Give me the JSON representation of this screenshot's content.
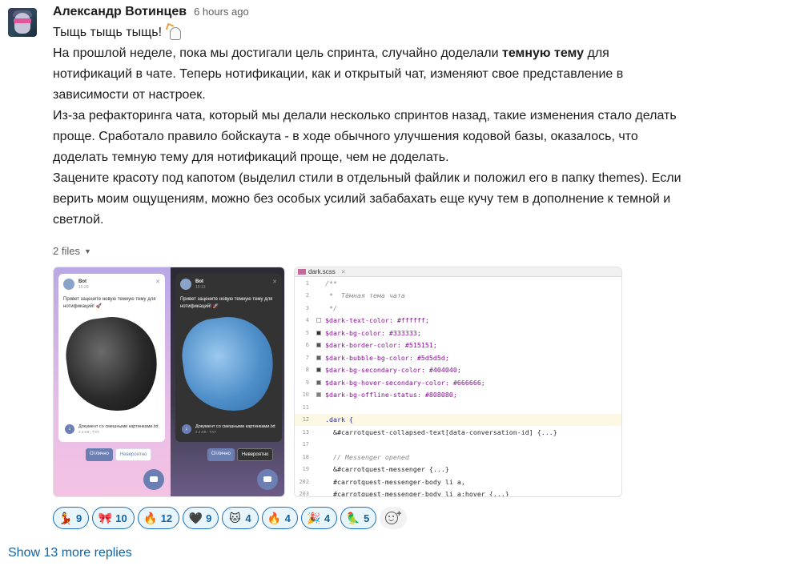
{
  "message": {
    "author": "Александр Вотинцев",
    "time": "6 hours ago",
    "lines": [
      "Тыщь тыщь тыщь!",
      "На прошлой неделе, пока мы достигали цель спринта, случайно доделали ",
      "темную тему",
      " для",
      "нотификаций в чате. Теперь нотификации, как и открытый чат, изменяют свое представление в",
      "зависимости от настроек.",
      "Из-за рефакторинга чата, который мы делали несколько спринтов назад, такие изменения стало делать",
      "проще. Сработало правило бойскаута - в ходе обычного улучшения кодовой базы, оказалось, что",
      "доделать темную тему для нотификаций проще, чем не доделать.",
      "Зацените красоту под капотом (выделил стили в отдельный файлик и положил его в папку themes). Если",
      "верить моим ощущениям, можно без особых усилий забабахать еще кучу тем в дополнение к темной и",
      "светлой."
    ],
    "first_line_emoji": "ghost-party-emoji"
  },
  "files": {
    "toggle_label": "2 files",
    "preview": {
      "bot_name": "Bot",
      "bot_time_light": "15:29",
      "bot_time_dark": "15:13",
      "text": "Привет зацените новую темную тему для нотификаций! 🚀",
      "doc_name": "Документ со смешными картинками.txt",
      "doc_meta": "2.4 KB - TXT",
      "btn_primary": "Отлично",
      "btn_secondary": "Невероятно"
    },
    "editor": {
      "tab_name": "dark.scss",
      "line_numbers": [
        "1",
        "2",
        "3",
        "4",
        "5",
        "6",
        "7",
        "8",
        "9",
        "10",
        "11",
        "12",
        "13",
        "17",
        "18",
        "19",
        "202",
        "203"
      ],
      "lines": [
        "/**",
        " *  Тёмная тема чата",
        " */",
        "$dark-text-color: #ffffff;",
        "$dark-bg-color: #333333;",
        "$dark-border-color: #515151;",
        "$dark-bubble-bg-color: #5d5d5d;",
        "$dark-bg-secondary-color: #404040;",
        "$dark-bg-hover-secondary-color: #666666;",
        "$dark-bg-offline-status: #808080;",
        "",
        ".dark {",
        "  &#carrotquest-collapsed-text[data-conversation-id] {...}",
        "",
        "  // Messenger opened",
        "  &#carrotquest-messenger {...}",
        "  #carrotquest-messenger-body li a,",
        "  #carrotquest-messenger-body li a:hover {...}"
      ],
      "swatches": [
        "#ffffff",
        "#333333",
        "#515151",
        "#5d5d5d",
        "#404040",
        "#666666",
        "#808080"
      ]
    }
  },
  "reactions": [
    {
      "icon": "dancer-emoji",
      "glyph": "💃",
      "count": "9"
    },
    {
      "icon": "pink-hat-emoji",
      "glyph": "🎀",
      "count": "10"
    },
    {
      "icon": "fire-crowd-emoji",
      "glyph": "🔥",
      "count": "12"
    },
    {
      "icon": "black-heart-emoji",
      "glyph": "🖤",
      "count": "9"
    },
    {
      "icon": "cat-photo-emoji",
      "glyph": "🐱",
      "count": "4"
    },
    {
      "icon": "fire-emoji",
      "glyph": "🔥",
      "count": "4"
    },
    {
      "icon": "party-popper-emoji",
      "glyph": "🎉",
      "count": "4"
    },
    {
      "icon": "parrot-emoji",
      "glyph": "🦜",
      "count": "5"
    }
  ],
  "show_more_replies": "Show 13 more replies",
  "colors": {
    "link": "#1264a3",
    "reaction_border": "#1d6fb8",
    "reaction_bg": "#e8f5fa"
  }
}
